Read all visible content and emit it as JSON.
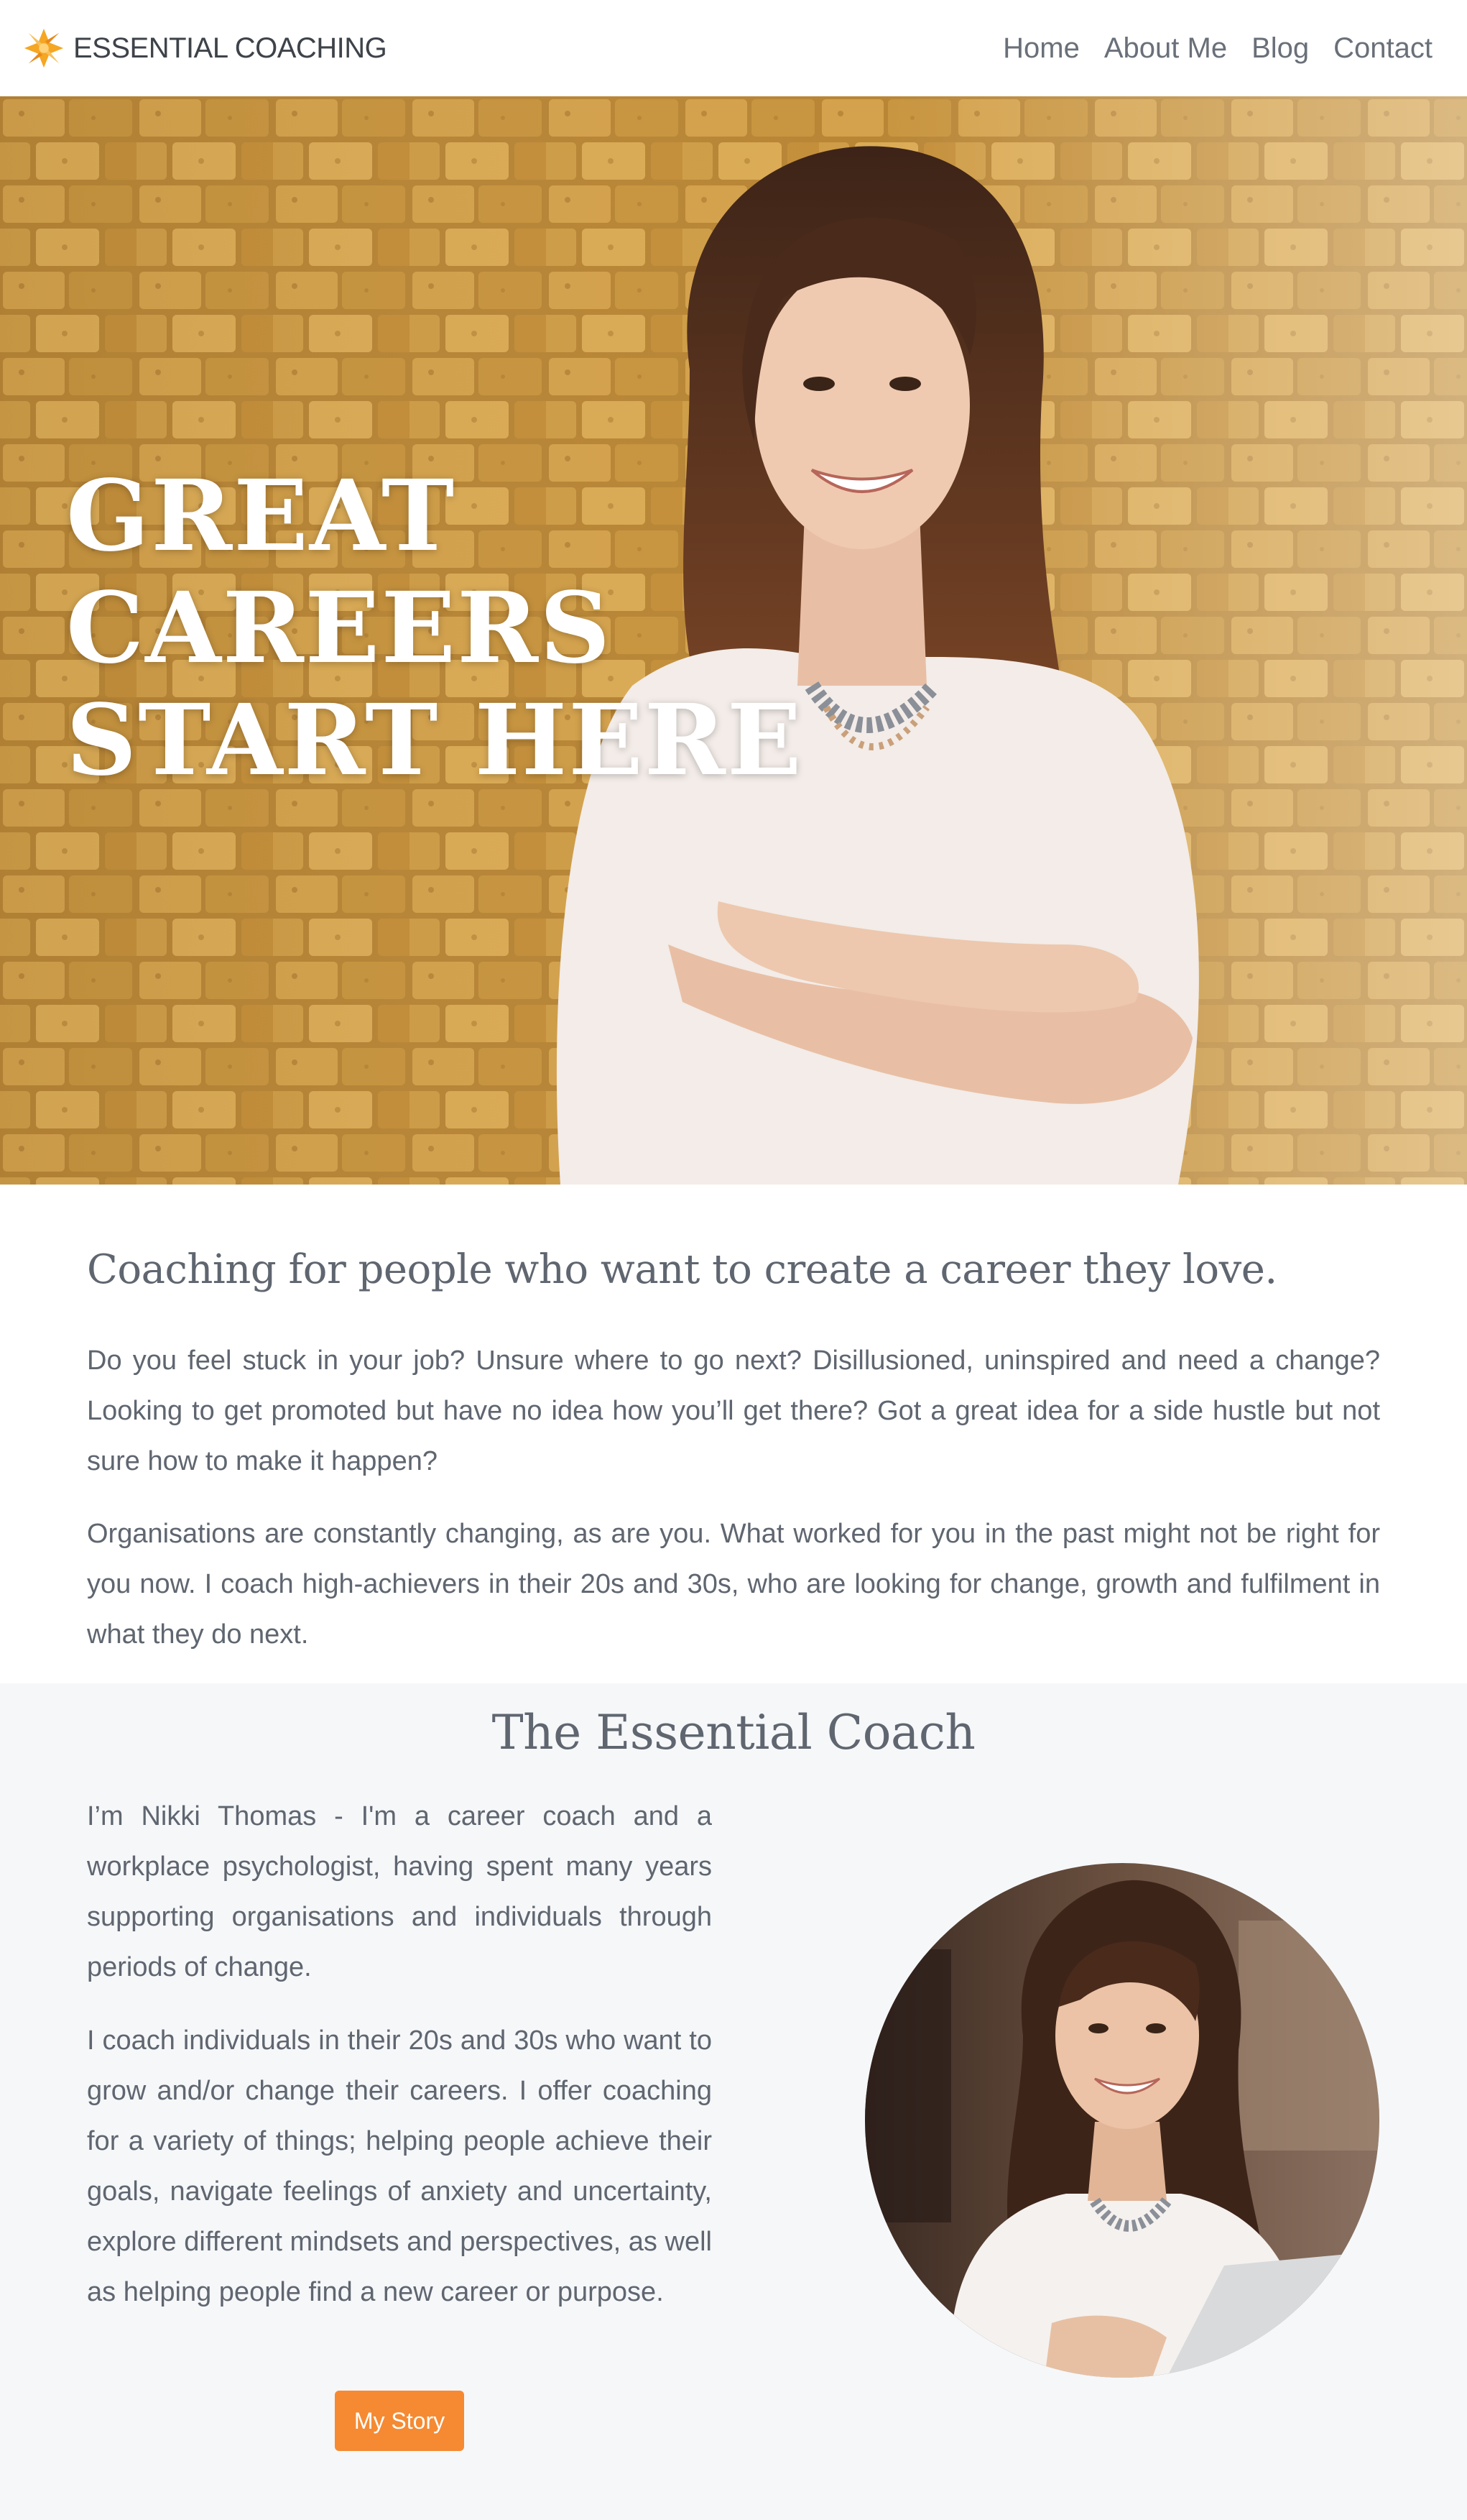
{
  "nav": {
    "brand_name": "ESSENTIAL COACHING",
    "logo_icon": "star-logo-icon",
    "links": [
      {
        "label": "Home"
      },
      {
        "label": "About Me"
      },
      {
        "label": "Blog"
      },
      {
        "label": "Contact"
      }
    ]
  },
  "hero": {
    "title_lines": [
      "GREAT",
      "CAREERS",
      "START HERE"
    ]
  },
  "intro": {
    "heading": "Coaching for people who want to create a career they love.",
    "paragraph_1": "Do you feel stuck in your job? Unsure where to go next? Disillusioned, uninspired and need a change? Looking to get promoted but have no idea how you’ll get there? Got a great idea for a side hustle but not sure how to make it happen?",
    "paragraph_2": "Organisations are constantly changing, as are you. What worked for you in the past might not be right for you now. I coach high-achievers in their 20s and 30s, who are looking for change, growth and fulfilment in what they do next."
  },
  "about": {
    "heading": "The Essential Coach",
    "paragraph_1": "I’m Nikki Thomas - I'm a career coach and a workplace psychologist, having spent many years supporting organisations and individuals through periods of change.",
    "paragraph_2": "I coach individuals in their 20s and 30s who want to grow and/or change their careers. I offer coaching for a variety of things; helping people achieve their goals, navigate feelings of anxiety and uncertainty, explore different mindsets and perspectives, as well as helping people find a new career or purpose.",
    "button_label": "My Story"
  },
  "colors": {
    "accent": "#f58a33",
    "text": "#5f6670",
    "section_bg": "#f6f7f9"
  }
}
